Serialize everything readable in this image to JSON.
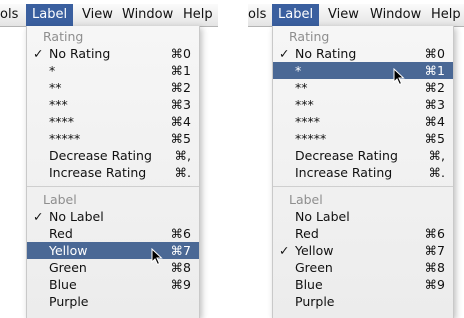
{
  "left": {
    "menubar": {
      "items": [
        "ols",
        "Label",
        "View",
        "Window",
        "Help"
      ],
      "active": "Label"
    },
    "menu": {
      "rating_header": "Rating",
      "rating_items": [
        {
          "label": "No Rating",
          "shortcut": "⌘0",
          "checked": true
        },
        {
          "label": "*",
          "shortcut": "⌘1"
        },
        {
          "label": "**",
          "shortcut": "⌘2"
        },
        {
          "label": "***",
          "shortcut": "⌘3"
        },
        {
          "label": "****",
          "shortcut": "⌘4"
        },
        {
          "label": "*****",
          "shortcut": "⌘5"
        },
        {
          "label": "Decrease Rating",
          "shortcut": "⌘,"
        },
        {
          "label": "Increase Rating",
          "shortcut": "⌘."
        }
      ],
      "label_header": "Label",
      "label_items": [
        {
          "label": "No Label",
          "shortcut": "",
          "checked": true
        },
        {
          "label": "Red",
          "shortcut": "⌘6"
        },
        {
          "label": "Yellow",
          "shortcut": "⌘7",
          "highlighted": true
        },
        {
          "label": "Green",
          "shortcut": "⌘8"
        },
        {
          "label": "Blue",
          "shortcut": "⌘9"
        },
        {
          "label": "Purple",
          "shortcut": ""
        }
      ]
    }
  },
  "right": {
    "menubar": {
      "items": [
        "ols",
        "Label",
        "View",
        "Window",
        "Help"
      ],
      "active": "Label"
    },
    "menu": {
      "rating_header": "Rating",
      "rating_items": [
        {
          "label": "No Rating",
          "shortcut": "⌘0",
          "checked": true
        },
        {
          "label": "*",
          "shortcut": "⌘1",
          "highlighted": true
        },
        {
          "label": "**",
          "shortcut": "⌘2"
        },
        {
          "label": "***",
          "shortcut": "⌘3"
        },
        {
          "label": "****",
          "shortcut": "⌘4"
        },
        {
          "label": "*****",
          "shortcut": "⌘5"
        },
        {
          "label": "Decrease Rating",
          "shortcut": "⌘,"
        },
        {
          "label": "Increase Rating",
          "shortcut": "⌘."
        }
      ],
      "label_header": "Label",
      "label_items": [
        {
          "label": "No Label",
          "shortcut": ""
        },
        {
          "label": "Red",
          "shortcut": "⌘6"
        },
        {
          "label": "Yellow",
          "shortcut": "⌘7",
          "checked": true
        },
        {
          "label": "Green",
          "shortcut": "⌘8"
        },
        {
          "label": "Blue",
          "shortcut": "⌘9"
        },
        {
          "label": "Purple",
          "shortcut": ""
        }
      ]
    }
  },
  "check_glyph": "✓",
  "colors": {
    "highlight": "#4a6895",
    "menubar_active": "#3a5f9f",
    "header_text": "#8e8e8e"
  }
}
